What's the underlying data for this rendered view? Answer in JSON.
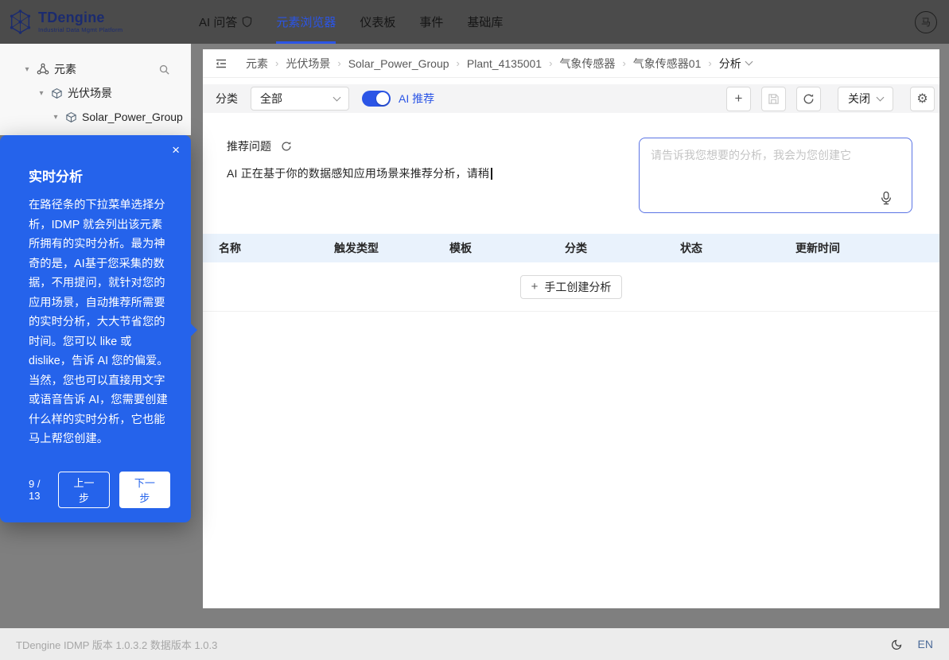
{
  "nav": {
    "logo": {
      "title": "TDengine",
      "subtitle": "Industrial Data Mgmt Platform"
    },
    "items": [
      {
        "label": "AI 问答"
      },
      {
        "label": "元素浏览器"
      },
      {
        "label": "仪表板"
      },
      {
        "label": "事件"
      },
      {
        "label": "基础库"
      }
    ],
    "active_item": "元素浏览器",
    "avatar_glyph": "马"
  },
  "sidebar": {
    "tree": [
      {
        "label": "元素"
      },
      {
        "label": "光伏场景"
      },
      {
        "label": "Solar_Power_Group"
      }
    ]
  },
  "breadcrumb": {
    "items": [
      "元素",
      "光伏场景",
      "Solar_Power_Group",
      "Plant_4135001",
      "气象传感器",
      "气象传感器01"
    ],
    "current": "分析"
  },
  "toolbar": {
    "category_label": "分类",
    "category_value": "全部",
    "ai_toggle_on": true,
    "ai_toggle_label": "AI 推荐",
    "close_button": "关闭"
  },
  "content": {
    "recommend_title": "推荐问题",
    "recommend_typing": "AI 正在基于你的数据感知应用场景来推荐分析，请稍",
    "prompt_placeholder": "请告诉我您想要的分析，我会为您创建它",
    "table_headers": [
      "名称",
      "触发类型",
      "模板",
      "分类",
      "状态",
      "更新时间"
    ],
    "empty_create_button": "手工创建分析"
  },
  "tour": {
    "title": "实时分析",
    "body": "在路径条的下拉菜单选择分析，IDMP 就会列出该元素所拥有的实时分析。最为神奇的是，AI基于您采集的数据，不用提问，就针对您的应用场景，自动推荐所需要的实时分析，大大节省您的时间。您可以 like 或 dislike，告诉 AI 您的偏爱。当然，您也可以直接用文字或语音告诉 AI，您需要创建什么样的实时分析，它也能马上帮您创建。",
    "step": "9 / 13",
    "prev_label": "上一步",
    "next_label": "下一步"
  },
  "footer": {
    "version": "TDengine IDMP 版本 1.0.3.2 数据版本 1.0.3",
    "lang": "EN"
  },
  "icons": {
    "plus": "+",
    "close": "×",
    "gear": "⚙",
    "caret_down": "▾",
    "breadcrumb_separator": "›"
  },
  "colors": {
    "accent": "#2b55e6",
    "tour_bg": "#2563eb",
    "table_header_bg": "#e9f2fc",
    "nav_bg": "#4b4b4b"
  }
}
